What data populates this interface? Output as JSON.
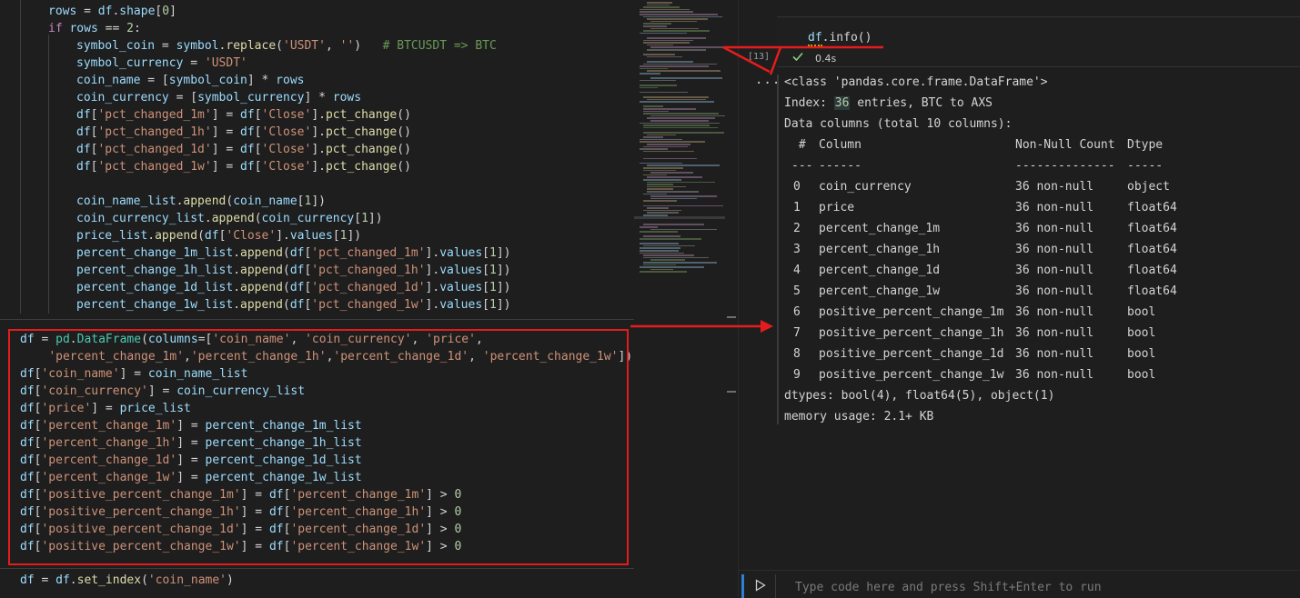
{
  "editor": {
    "lines_top": [
      "rows = df.shape[0]",
      "if rows == 2:",
      "symbol_coin = symbol.replace('USDT', '')   # BTCUSDT => BTC",
      "symbol_currency = 'USDT'",
      "coin_name = [symbol_coin] * rows",
      "coin_currency = [symbol_currency] * rows",
      "df['pct_changed_1m'] = df['Close'].pct_change()",
      "df['pct_changed_1h'] = df['Close'].pct_change()",
      "df['pct_changed_1d'] = df['Close'].pct_change()",
      "df['pct_changed_1w'] = df['Close'].pct_change()",
      "",
      "coin_name_list.append(coin_name[1])",
      "coin_currency_list.append(coin_currency[1])",
      "price_list.append(df['Close'].values[1])",
      "percent_change_1m_list.append(df['pct_changed_1m'].values[1])",
      "percent_change_1h_list.append(df['pct_changed_1h'].values[1])",
      "percent_change_1d_list.append(df['pct_changed_1d'].values[1])",
      "percent_change_1w_list.append(df['pct_changed_1w'].values[1])"
    ],
    "lines_box": [
      "df = pd.DataFrame(columns=['coin_name', 'coin_currency', 'price',",
      "    'percent_change_1m','percent_change_1h','percent_change_1d', 'percent_change_1w'])",
      "df['coin_name'] = coin_name_list",
      "df['coin_currency'] = coin_currency_list",
      "df['price'] = price_list",
      "df['percent_change_1m'] = percent_change_1m_list",
      "df['percent_change_1h'] = percent_change_1h_list",
      "df['percent_change_1d'] = percent_change_1d_list",
      "df['percent_change_1w'] = percent_change_1w_list",
      "df['positive_percent_change_1m'] = df['percent_change_1m'] > 0",
      "df['positive_percent_change_1h'] = df['percent_change_1h'] > 0",
      "df['positive_percent_change_1d'] = df['percent_change_1d'] > 0",
      "df['positive_percent_change_1w'] = df['percent_change_1w'] > 0"
    ],
    "line_bottom": "df = df.set_index('coin_name')"
  },
  "cell": {
    "execution_count": "[13]",
    "input_fn": "df",
    "input_rest": ".info()",
    "status": "✓",
    "exec_time": "0.4s",
    "more": "..."
  },
  "output": {
    "class_line": "<class 'pandas.core.frame.DataFrame'>",
    "index_prefix": "Index: ",
    "index_count": "36",
    "index_suffix": " entries, BTC to AXS",
    "data_columns": "Data columns (total 10 columns):",
    "header": {
      "num": " #",
      "column": "Column",
      "nonnull": "Non-Null Count",
      "dtype": "Dtype"
    },
    "sep": {
      "num": "---",
      "column": "------",
      "nonnull": "--------------",
      "dtype": "-----"
    },
    "rows": [
      {
        "num": "0",
        "column": "coin_currency",
        "nonnull": "36 non-null",
        "dtype": "object"
      },
      {
        "num": "1",
        "column": "price",
        "nonnull": "36 non-null",
        "dtype": "float64"
      },
      {
        "num": "2",
        "column": "percent_change_1m",
        "nonnull": "36 non-null",
        "dtype": "float64"
      },
      {
        "num": "3",
        "column": "percent_change_1h",
        "nonnull": "36 non-null",
        "dtype": "float64"
      },
      {
        "num": "4",
        "column": "percent_change_1d",
        "nonnull": "36 non-null",
        "dtype": "float64"
      },
      {
        "num": "5",
        "column": "percent_change_1w",
        "nonnull": "36 non-null",
        "dtype": "float64"
      },
      {
        "num": "6",
        "column": "positive_percent_change_1m",
        "nonnull": "36 non-null",
        "dtype": "bool"
      },
      {
        "num": "7",
        "column": "positive_percent_change_1h",
        "nonnull": "36 non-null",
        "dtype": "bool"
      },
      {
        "num": "8",
        "column": "positive_percent_change_1d",
        "nonnull": "36 non-null",
        "dtype": "bool"
      },
      {
        "num": "9",
        "column": "positive_percent_change_1w",
        "nonnull": "36 non-null",
        "dtype": "bool"
      }
    ],
    "dtypes_line": "dtypes: bool(4), float64(5), object(1)",
    "memory_line": "memory usage: 2.1+ KB"
  },
  "command_bar": {
    "placeholder": "Type code here and press Shift+Enter to run"
  },
  "colors": {
    "annotation_red": "#e51c1c",
    "accent_blue": "#2f7fd3",
    "success_green": "#89d185"
  }
}
